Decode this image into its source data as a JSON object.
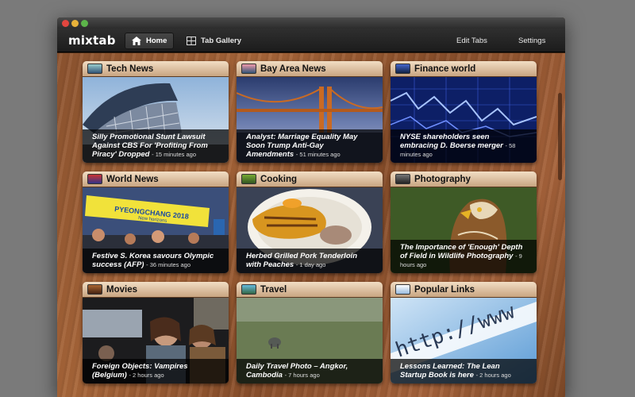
{
  "app": {
    "name": "mixtab"
  },
  "toolbar": {
    "home_label": "Home",
    "gallery_label": "Tab Gallery",
    "edit_label": "Edit Tabs",
    "settings_label": "Settings"
  },
  "tiles": [
    {
      "title": "Tech News",
      "headline": "Silly Promotional Stunt Lawsuit Against CBS For 'Profiting From Piracy' Dropped",
      "ago": "- 15 minutes ago",
      "icon": "laptop-icon"
    },
    {
      "title": "Bay Area News",
      "headline": "Analyst: Marriage Equality May Soon Trump Anti-Gay Amendments",
      "ago": "- 51 minutes ago",
      "icon": "city-icon"
    },
    {
      "title": "Finance world",
      "headline": "NYSE shareholders seen embracing D. Boerse merger",
      "ago": "- 58 minutes ago",
      "icon": "chart-icon"
    },
    {
      "title": "World News",
      "headline": "Festive S. Korea savours Olympic success (AFP)",
      "ago": "- 36 minutes ago",
      "icon": "globe-icon"
    },
    {
      "title": "Cooking",
      "headline": "Herbed Grilled Pork Tenderloin with Peaches",
      "ago": "- 1 day ago",
      "icon": "dish-icon"
    },
    {
      "title": "Photography",
      "headline": "The Importance of 'Enough' Depth of Field in Wildlife Photography",
      "ago": "- 9 hours ago",
      "icon": "camera-icon"
    },
    {
      "title": "Movies",
      "headline": "Foreign Objects: Vampires (Belgium)",
      "ago": "- 2 hours ago",
      "icon": "film-icon"
    },
    {
      "title": "Travel",
      "headline": "Daily Travel Photo – Angkor, Cambodia",
      "ago": "- 7 hours ago",
      "icon": "landscape-icon"
    },
    {
      "title": "Popular Links",
      "headline": "Lessons Learned: The Lean Startup Book is here",
      "ago": "- 2 hours ago",
      "icon": "link-icon"
    }
  ],
  "images": {
    "world_banner": "PYEONGCHANG 2018",
    "world_banner_sub": "New horizons",
    "link_text": "http://www"
  }
}
